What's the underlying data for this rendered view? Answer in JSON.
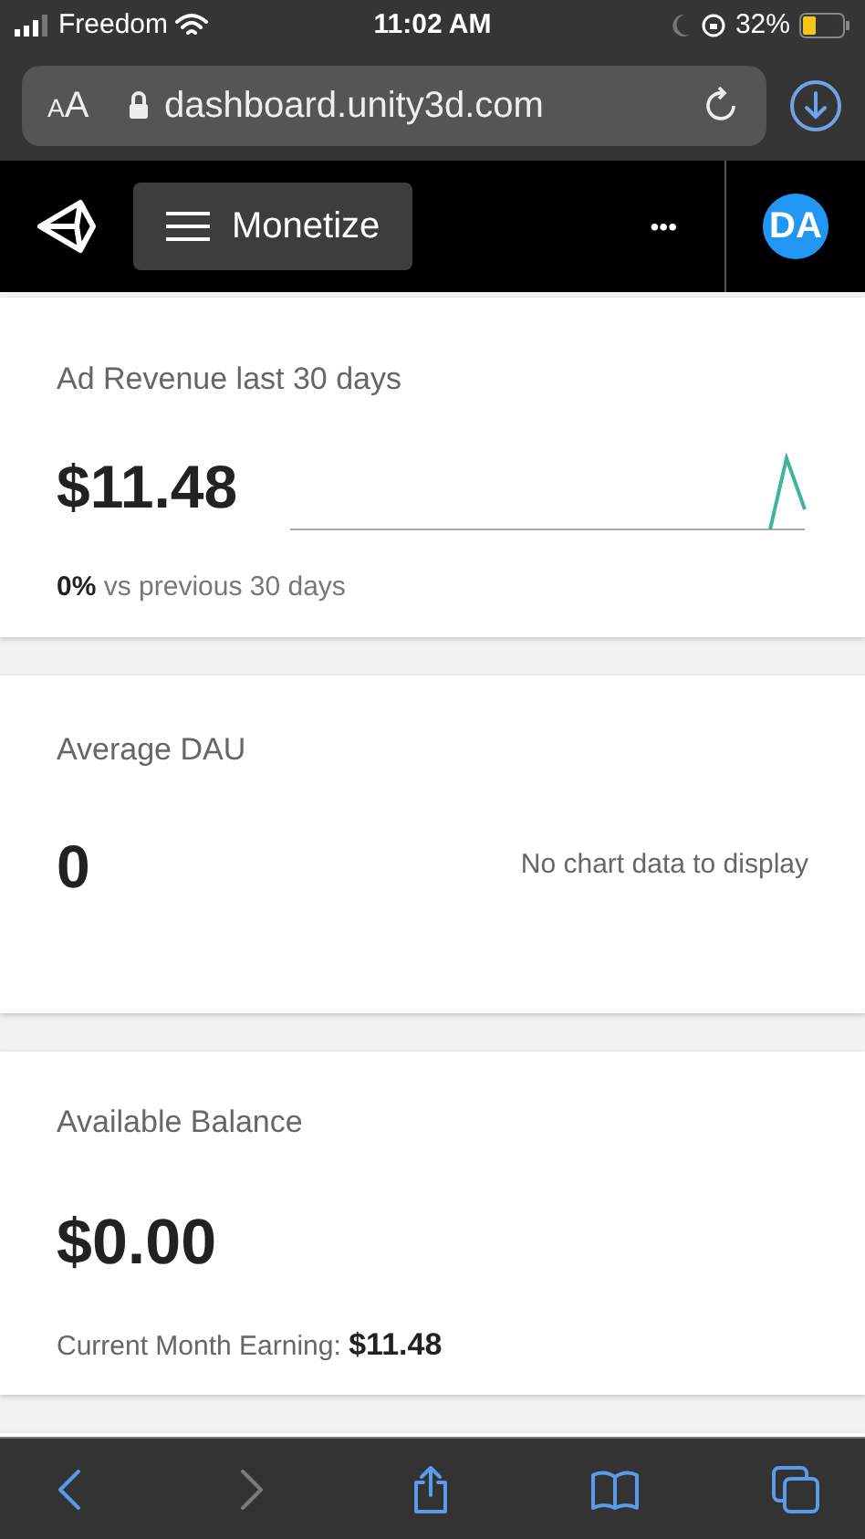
{
  "status_bar": {
    "carrier": "Freedom",
    "time": "11:02 AM",
    "battery": "32%"
  },
  "address_bar": {
    "text_size_button": "AA",
    "url": "dashboard.unity3d.com"
  },
  "nav": {
    "menu_label": "Monetize",
    "more": "•••",
    "avatar": "DA"
  },
  "cards": [
    {
      "kind": "revenue",
      "title": "Ad Revenue last 30 days",
      "value": "$11.48",
      "change": "0%",
      "change_label": "vs previous 30 days"
    },
    {
      "kind": "empty_chart",
      "title": "Average DAU",
      "value": "0",
      "note": "No chart data to display"
    },
    {
      "kind": "balance",
      "title": "Available Balance",
      "value": "$0.00",
      "footer_label": "Current Month Earning:",
      "footer_value": "$11.48"
    }
  ],
  "toolbar": [
    {
      "kind": "back",
      "disabled": false
    },
    {
      "kind": "forward",
      "disabled": true
    },
    {
      "kind": "share",
      "disabled": false
    },
    {
      "kind": "bookmarks",
      "disabled": false
    },
    {
      "kind": "tabs",
      "disabled": false
    }
  ]
}
